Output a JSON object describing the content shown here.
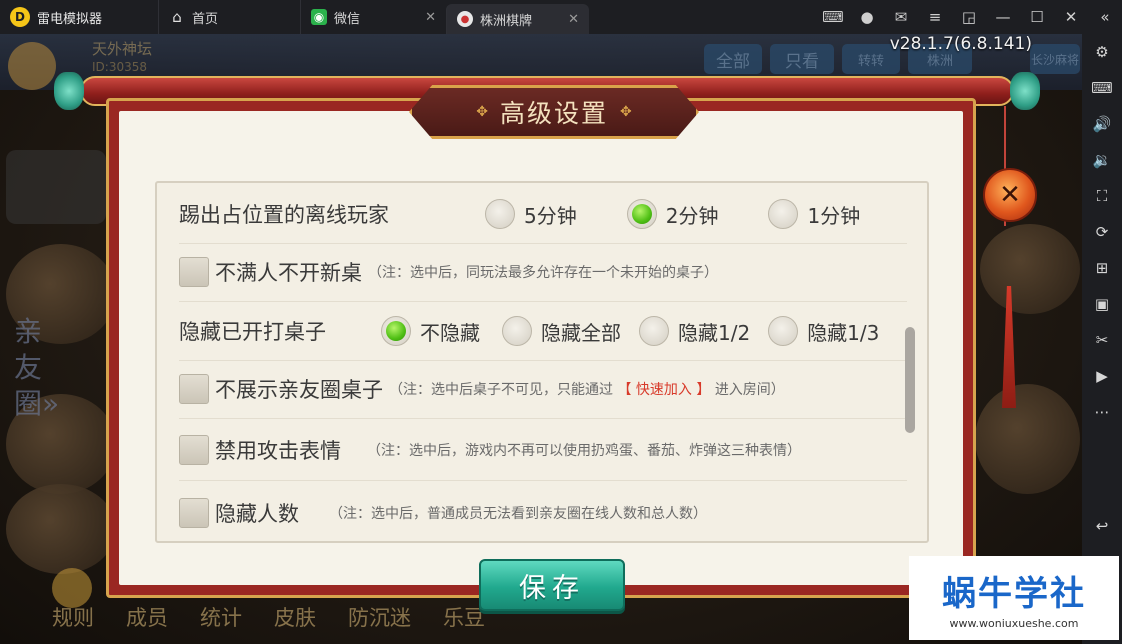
{
  "titlebar": {
    "app_name": "雷电模拟器",
    "tabs": [
      {
        "label": "首页"
      },
      {
        "label": "微信"
      },
      {
        "label": "株洲棋牌"
      }
    ]
  },
  "game": {
    "version": "v28.1.7(6.8.141)",
    "background": {
      "club_name": "天外神坛",
      "club_id": "ID:30358",
      "top_tabs": [
        "全部",
        "只看",
        "转转",
        "株洲",
        "长沙麻将"
      ],
      "side_text": "亲友圈»",
      "bottom_nav": [
        "规则",
        "成员",
        "统计",
        "皮肤",
        "防沉迷",
        "乐豆"
      ]
    }
  },
  "dialog": {
    "title": "高级设置",
    "kick_offline": {
      "label": "踢出占位置的离线玩家",
      "options": [
        "5分钟",
        "2分钟",
        "1分钟"
      ],
      "selected": "2分钟"
    },
    "not_full_no_new": {
      "label": "不满人不开新桌",
      "note": "（注：选中后，同玩法最多允许存在一个未开始的桌子）"
    },
    "hide_started": {
      "label": "隐藏已开打桌子",
      "options": [
        "不隐藏",
        "隐藏全部",
        "隐藏1/2",
        "隐藏1/3"
      ],
      "selected": "不隐藏"
    },
    "hide_club_tables": {
      "label": "不展示亲友圈桌子",
      "note_before": "（注：选中后桌子不可见，只能通过",
      "note_highlight": "【 快速加入 】",
      "note_after": "进入房间）"
    },
    "disable_attack": {
      "label": "禁用攻击表情",
      "note": "（注：选中后，游戏内不再可以使用扔鸡蛋、番茄、炸弹这三种表情）"
    },
    "hide_count": {
      "label": "隐藏人数",
      "note": "（注：选中后，普通成员无法看到亲友圈在线人数和总人数）"
    },
    "save_label": "保存"
  },
  "watermark": {
    "title": "蜗牛学社",
    "url": "www.woniuxueshe.com"
  },
  "colors": {
    "dialog_frame": "#9a2722",
    "gold": "#d7a44e",
    "save_button": "#21a98e",
    "radio_selected": "#4fbf14",
    "note_highlight": "#d83a2a"
  }
}
